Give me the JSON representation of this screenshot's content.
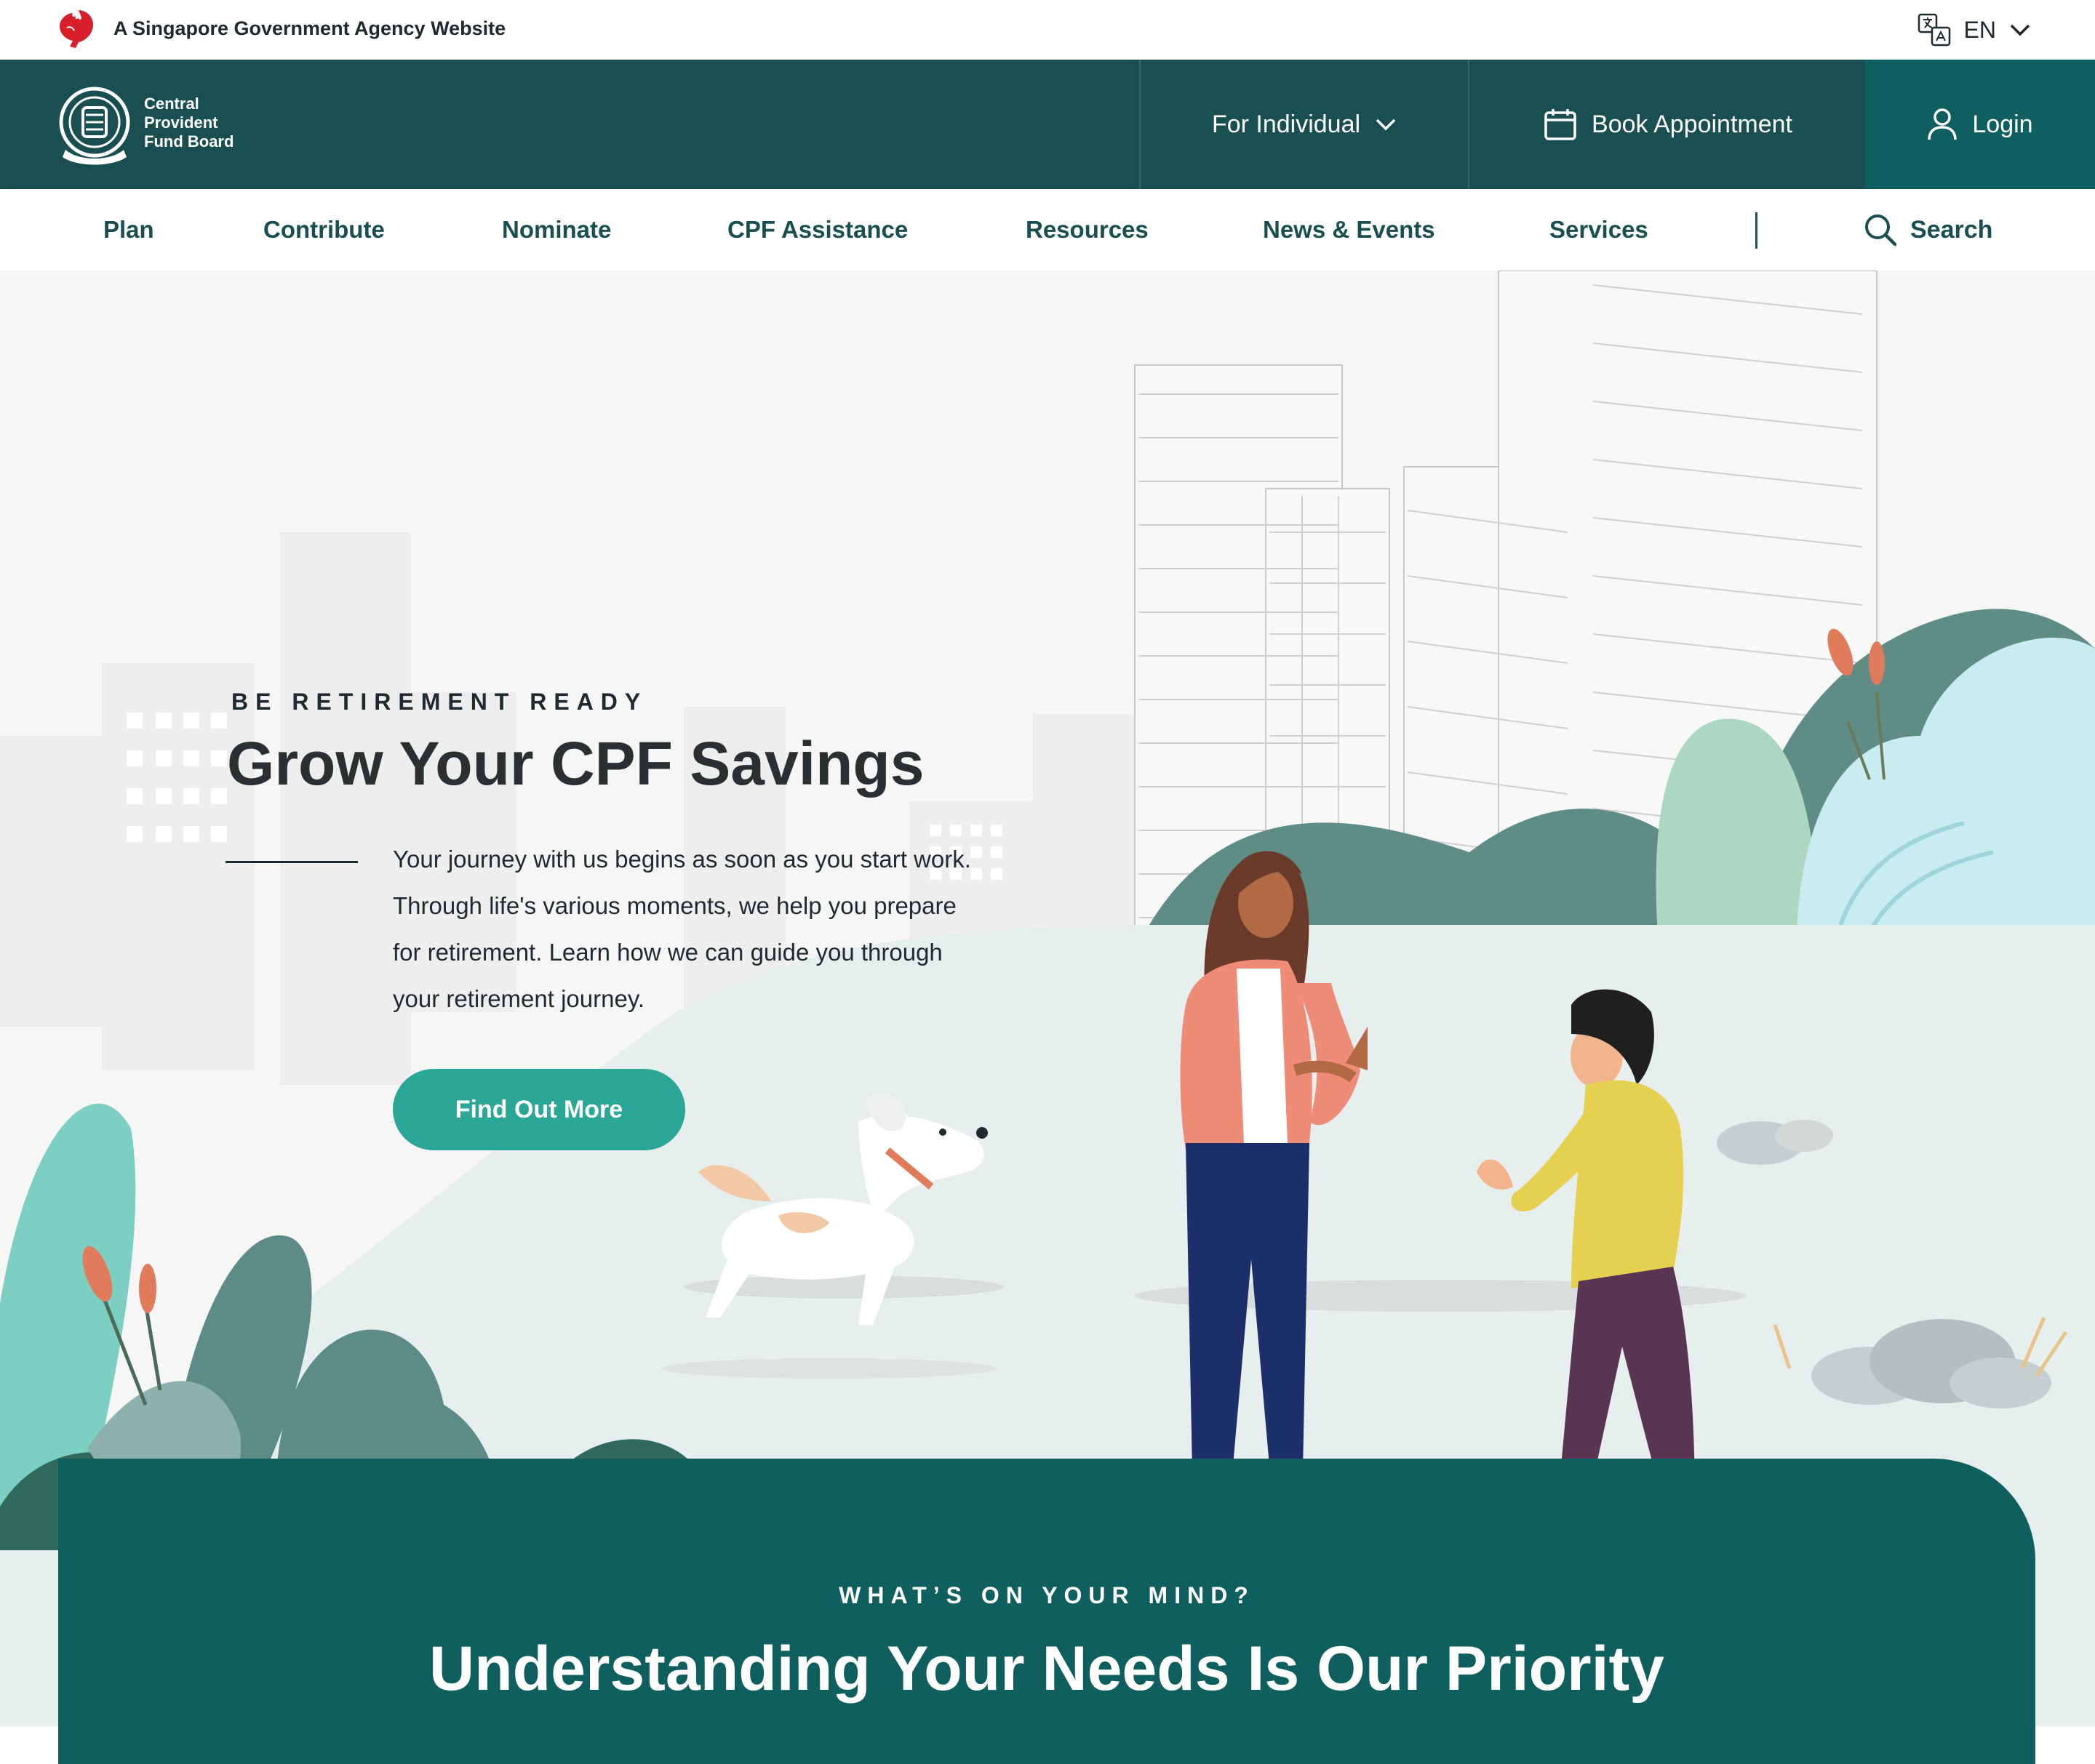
{
  "masthead": {
    "gov_text": "A Singapore Government Agency Website",
    "language": "EN"
  },
  "brand": {
    "logo_lines": [
      "Central",
      "Provident",
      "Fund Board"
    ],
    "for_individual": "For Individual",
    "book_appointment": "Book Appointment",
    "login": "Login"
  },
  "nav": {
    "items": [
      "Plan",
      "Contribute",
      "Nominate",
      "CPF Assistance",
      "Resources",
      "News & Events",
      "Services"
    ],
    "search": "Search"
  },
  "hero": {
    "eyebrow": "BE RETIREMENT READY",
    "title": "Grow Your CPF Savings",
    "body_lines": [
      "Your journey with us begins as soon as you start work.",
      "Through life's various moments, we help you prepare",
      "for retirement. Learn how we can guide you through",
      "your retirement journey."
    ],
    "cta": "Find Out More"
  },
  "priority": {
    "eyebrow": "WHAT’S ON YOUR MIND?",
    "title": "Understanding Your Needs Is Our Priority"
  },
  "colors": {
    "brand_dark": "#1a4f52",
    "login_bg": "#0f5f61",
    "cta": "#2aa797",
    "panel": "#0f5f5e",
    "lion_red": "#d7202b"
  },
  "icons": [
    "lion-head-icon",
    "translate-icon",
    "chevron-down-icon",
    "calendar-icon",
    "user-icon",
    "search-icon"
  ]
}
